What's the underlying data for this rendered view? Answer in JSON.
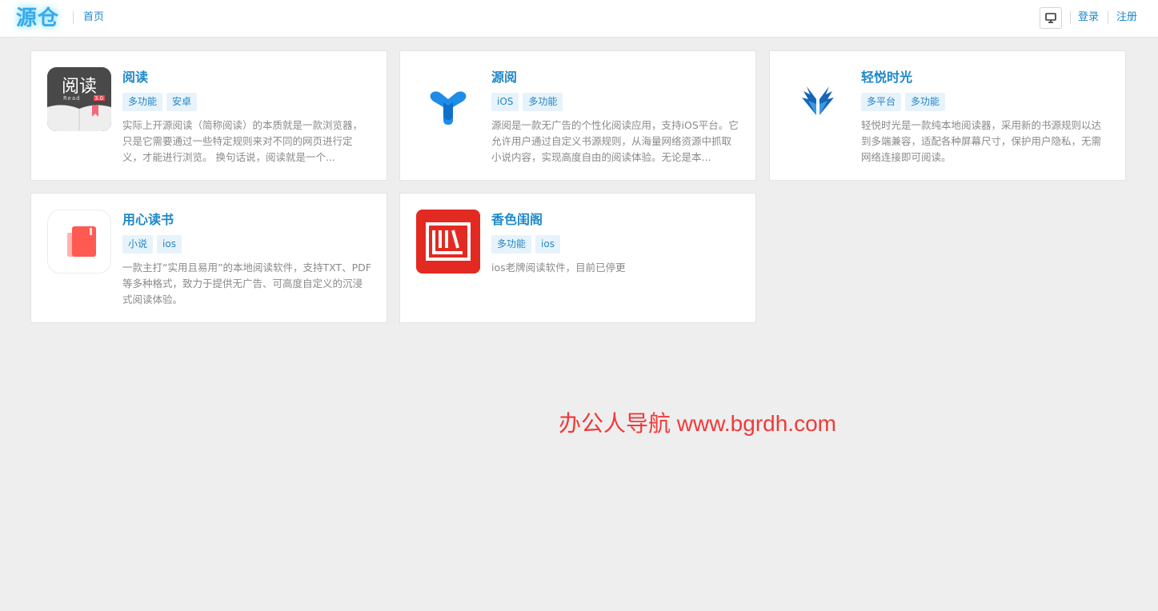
{
  "header": {
    "logo": "源仓",
    "nav_home": "首页",
    "monitor_icon": "monitor-icon",
    "login": "登录",
    "register": "注册"
  },
  "apps": [
    {
      "name": "阅读",
      "icon": "yuedu-app-icon",
      "icon_text": "阅读",
      "icon_subtext": "Read",
      "icon_version": "3.0",
      "tags": [
        "多功能",
        "安卓"
      ],
      "desc": "实际上开源阅读（简称阅读）的本质就是一款浏览器，只是它需要通过一些特定规则来对不同的网页进行定义，才能进行浏览。 换句话说，阅读就是一个..."
    },
    {
      "name": "源阅",
      "icon": "yuanyue-app-icon",
      "tags": [
        "iOS",
        "多功能"
      ],
      "desc": "源阅是一款无广告的个性化阅读应用，支持iOS平台。它允许用户通过自定义书源规则，从海量网络资源中抓取小说内容，实现高度自由的阅读体验。无论是本..."
    },
    {
      "name": "轻悦时光",
      "icon": "qingyue-app-icon",
      "tags": [
        "多平台",
        "多功能"
      ],
      "desc": "轻悦时光是一款纯本地阅读器，采用新的书源规则以达到多端兼容，适配各种屏幕尺寸，保护用户隐私，无需网络连接即可阅读。"
    },
    {
      "name": "用心读书",
      "icon": "yongxin-app-icon",
      "tags": [
        "小说",
        "ios"
      ],
      "desc": "一款主打“实用且易用”的本地阅读软件，支持TXT、PDF等多种格式，致力于提供无广告、可高度自定义的沉浸式阅读体验。"
    },
    {
      "name": "香色闺阁",
      "icon": "xiangse-app-icon",
      "tags": [
        "多功能",
        "ios"
      ],
      "desc": "ios老牌阅读软件，目前已停更"
    }
  ],
  "watermark": "办公人导航 www.bgrdh.com",
  "colors": {
    "link": "#1e88c8",
    "tag_bg": "#e7f3fb",
    "watermark": "#f03a3a",
    "background": "#eeeeee"
  }
}
